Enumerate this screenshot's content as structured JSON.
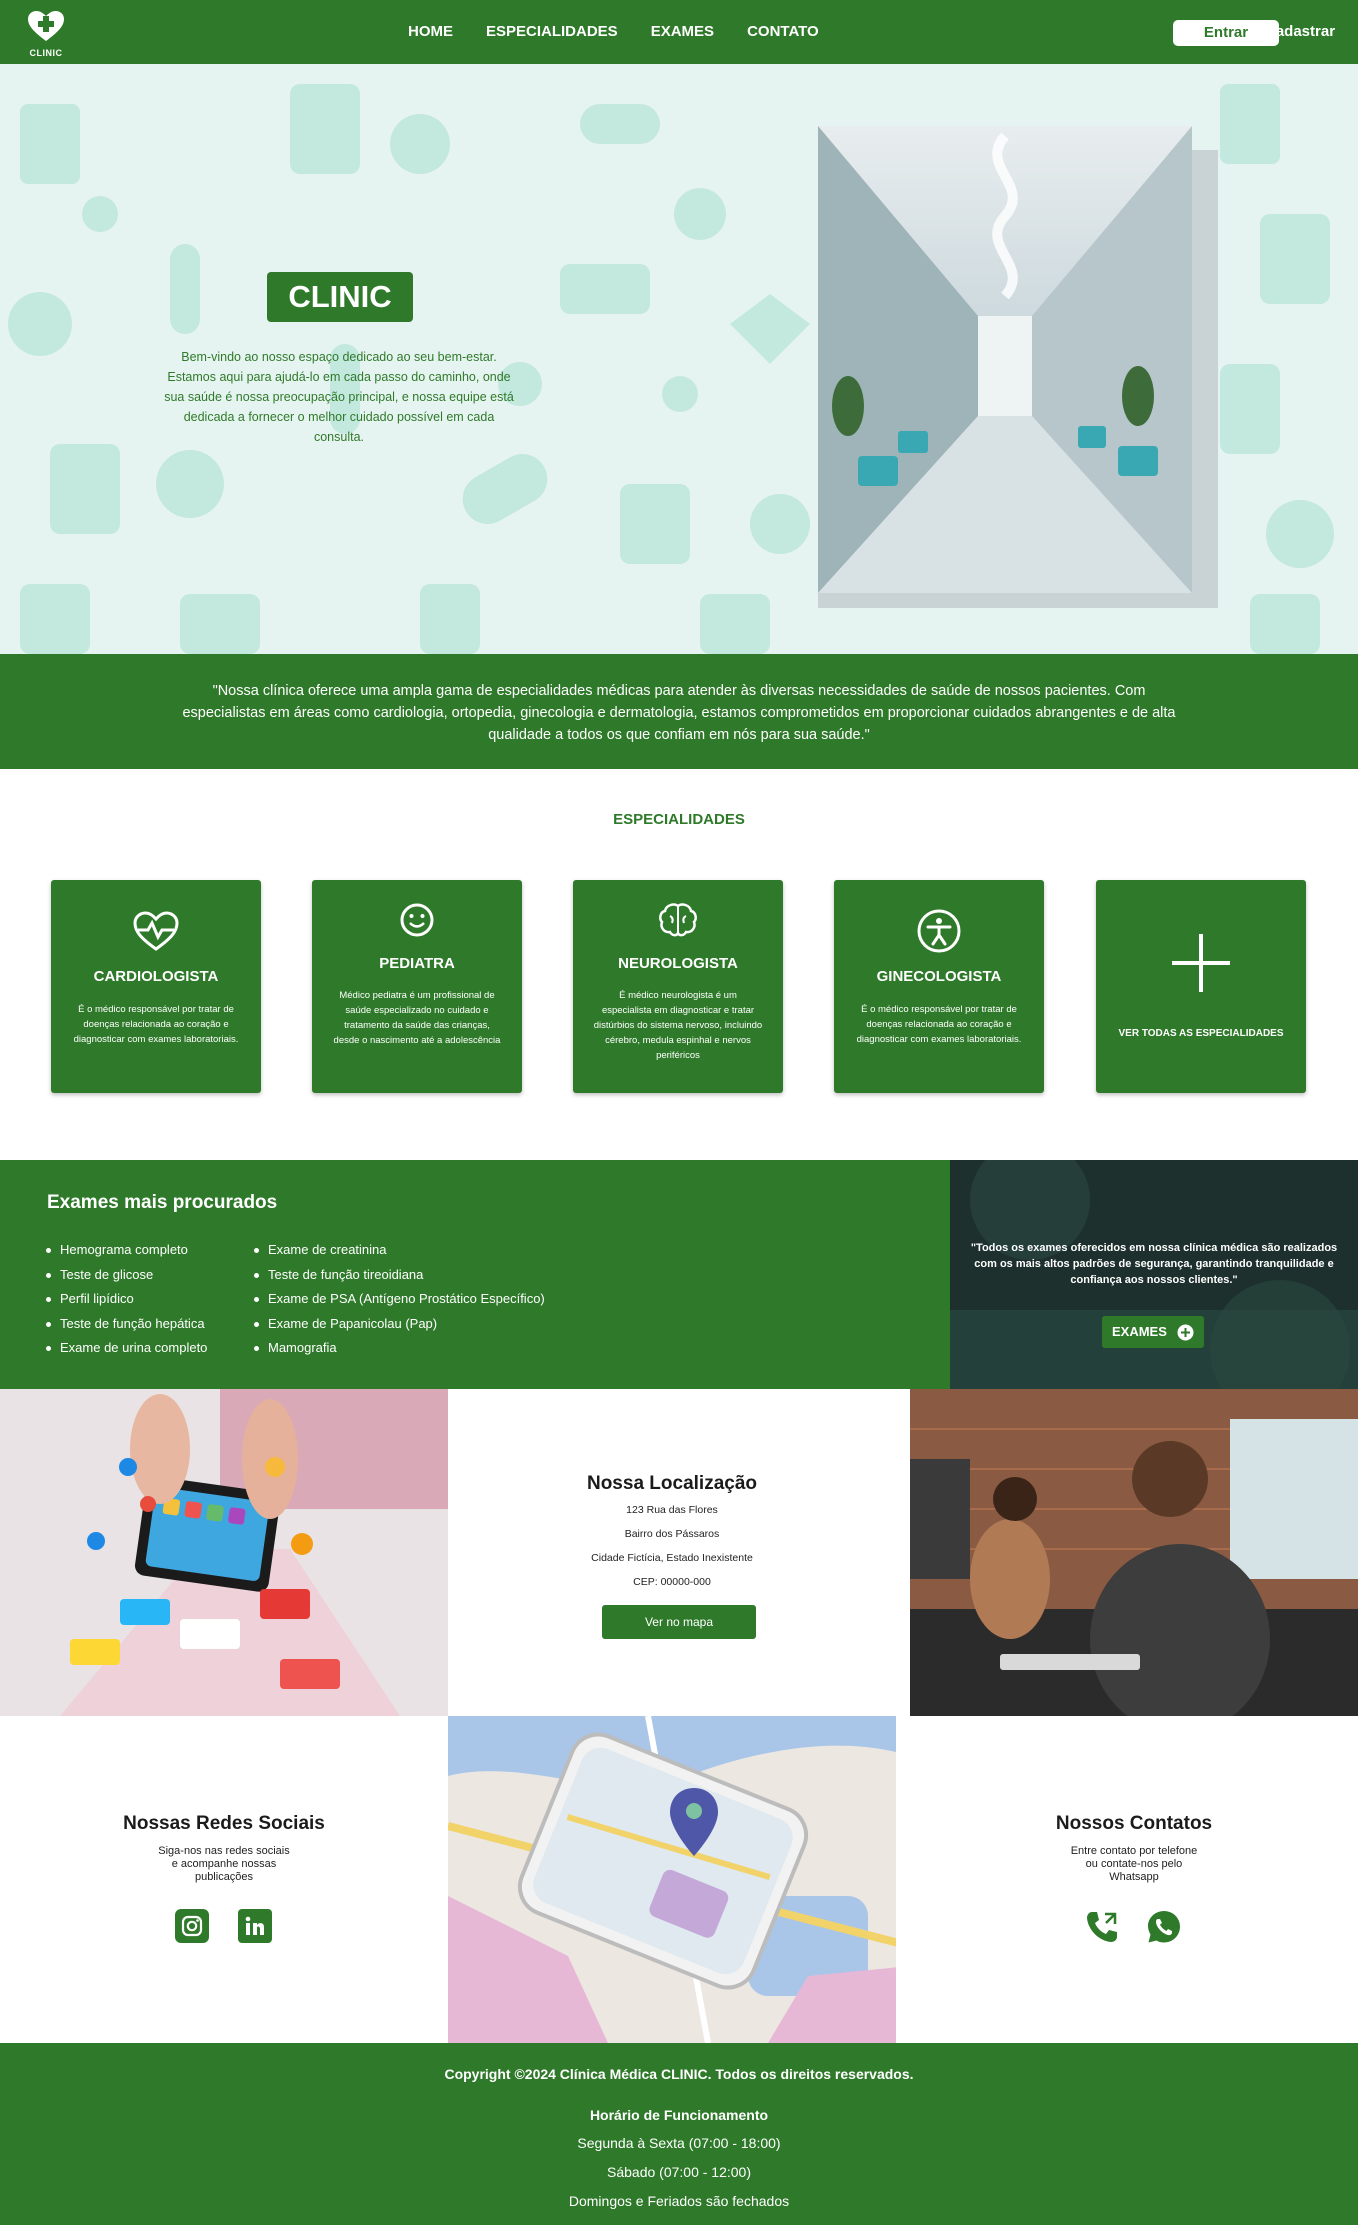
{
  "nav": {
    "logo_text": "CLINIC",
    "links": [
      "HOME",
      "ESPECIALIDADES",
      "EXAMES",
      "CONTATO"
    ],
    "login": "Entrar",
    "signup": "Cadastrar"
  },
  "hero": {
    "badge": "CLINIC",
    "text": "Bem-vindo ao nosso espaço dedicado ao seu bem-estar. Estamos aqui para ajudá-lo em cada passo do caminho, onde sua saúde é nossa preocupação principal, e nossa equipe está dedicada a fornecer o melhor cuidado possível em cada consulta."
  },
  "quote": "\"Nossa clínica oferece uma ampla gama de especialidades médicas para atender às diversas necessidades de saúde de nossos pacientes. Com especialistas em áreas como cardiologia, ortopedia, ginecologia e dermatologia, estamos comprometidos em proporcionar cuidados abrangentes e de alta qualidade a todos os que confiam em nós para sua saúde.\"",
  "specialties": {
    "title": "ESPECIALIDADES",
    "cards": [
      {
        "icon": "heart-pulse-icon",
        "title": "CARDIOLOGISTA",
        "desc": "É o médico responsável por tratar de doenças relacionada ao coração e diagnosticar com exames laboratoriais."
      },
      {
        "icon": "smiley-icon",
        "title": "PEDIATRA",
        "desc": "Médico pediatra é um profissional de saúde especializado no cuidado e tratamento da saúde das crianças, desde o nascimento até a adolescência"
      },
      {
        "icon": "brain-icon",
        "title": "NEUROLOGISTA",
        "desc": "É médico neurologista é um especialista em diagnosticar e tratar distúrbios do sistema nervoso, incluindo cérebro, medula espinhal e nervos periféricos"
      },
      {
        "icon": "accessibility-icon",
        "title": "GINECOLOGISTA",
        "desc": "É o médico responsável por tratar de doenças relacionada ao coração e diagnosticar com exames laboratoriais."
      },
      {
        "icon": "plus-icon",
        "title": "VER TODAS AS ESPECIALIDADES",
        "desc": ""
      }
    ]
  },
  "exams": {
    "title": "Exames mais procurados",
    "col1": [
      "Hemograma completo",
      "Teste de glicose",
      "Perfil lipídico",
      "Teste de função hepática",
      "Exame de urina completo"
    ],
    "col2": [
      "Exame de creatinina",
      "Teste de função tireoidiana",
      "Exame de PSA (Antígeno Prostático Específico)",
      "Exame de Papanicolau (Pap)",
      "Mamografia"
    ],
    "quote": "\"Todos os exames oferecidos em nossa clínica médica são realizados com os mais altos padrões de segurança, garantindo tranquilidade e confiança aos nossos clientes.\"",
    "button": "EXAMES"
  },
  "location": {
    "title": "Nossa Localização",
    "street": "123 Rua das Flores",
    "district": "Bairro dos Pássaros",
    "city": "Cidade Fictícia, Estado Inexistente",
    "cep": "CEP: 00000-000",
    "button": "Ver no mapa"
  },
  "social": {
    "title": "Nossas Redes Sociais",
    "subtitle_lines": [
      "Siga-nos nas redes sociais",
      "e acompanhe nossas",
      "publicações"
    ]
  },
  "contacts": {
    "title": "Nossos Contatos",
    "subtitle_lines": [
      "Entre contato por telefone",
      "ou contate-nos pelo",
      "Whatsapp"
    ]
  },
  "footer": {
    "copyright": "Copyright ©2024 Clínica Médica CLINIC. Todos os direitos reservados.",
    "hours_title": "Horário de Funcionamento",
    "weekdays": "Segunda à Sexta (07:00 - 18:00)",
    "saturday": "Sábado (07:00 - 12:00)",
    "sunday": "Domingos e Feriados são fechados"
  },
  "colors": {
    "primary": "#2f7a2a",
    "hero_bg": "#e6f4f1",
    "pattern": "#bfe6dc"
  }
}
